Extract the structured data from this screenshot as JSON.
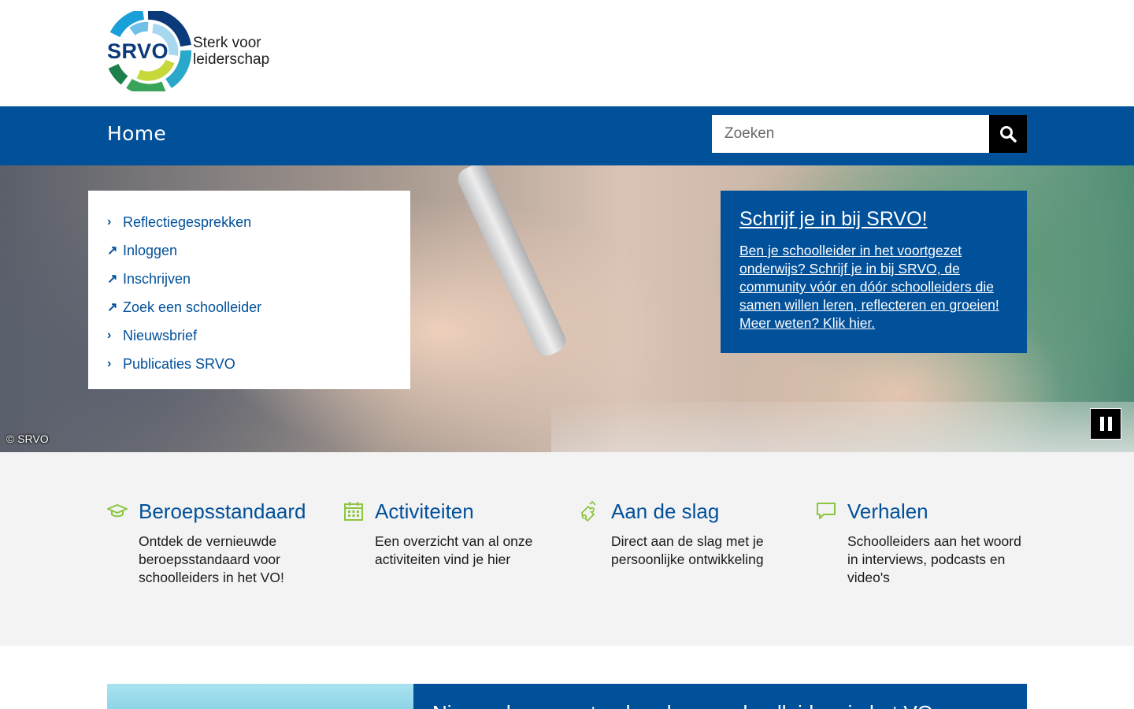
{
  "header": {
    "logo_text": "SRVO",
    "logo_tagline_line1": "Sterk voor",
    "logo_tagline_line2": "leiderschap"
  },
  "nav": {
    "home_label": "Home",
    "search_placeholder": "Zoeken"
  },
  "hero": {
    "credit": "© SRVO",
    "quicklinks": [
      {
        "label": "Reflectiegesprekken",
        "icon": "chevron-right-icon"
      },
      {
        "label": "Inloggen",
        "icon": "external-link-icon"
      },
      {
        "label": "Inschrijven",
        "icon": "external-link-icon"
      },
      {
        "label": "Zoek een schoolleider",
        "icon": "external-link-icon"
      },
      {
        "label": "Nieuwsbrief",
        "icon": "chevron-right-icon"
      },
      {
        "label": "Publicaties SRVO",
        "icon": "chevron-right-icon"
      }
    ],
    "promo_title": "Schrijf je in bij SRVO!",
    "promo_text": "Ben je schoolleider in het voortgezet onderwijs? Schrijf je in bij SRVO, de community vóór en dóór schoolleiders die samen willen leren, reflecteren en groeien! Meer weten? Klik hier."
  },
  "features": [
    {
      "title": "Beroepsstandaard",
      "desc": "Ontdek de vernieuwde beroepsstandaard voor schoolleiders in het VO!",
      "icon": "graduation-cap-icon"
    },
    {
      "title": "Activiteiten",
      "desc": "Een overzicht van al onze activiteiten vind je hier",
      "icon": "calendar-icon"
    },
    {
      "title": "Aan de slag",
      "desc": "Direct aan de slag met je persoonlijke ontwikkeling",
      "icon": "puzzle-icon"
    },
    {
      "title": "Verhalen",
      "desc": "Schoolleiders aan het woord in interviews, podcasts en video's",
      "icon": "speech-bubble-icon"
    }
  ],
  "teaser": {
    "title": "Nieuwe beroepsstandaard voor schoolleiders in het VO"
  },
  "colors": {
    "brand_blue": "#01509a",
    "accent_green": "#8cc63f",
    "feature_bg": "#f3f3f3"
  }
}
